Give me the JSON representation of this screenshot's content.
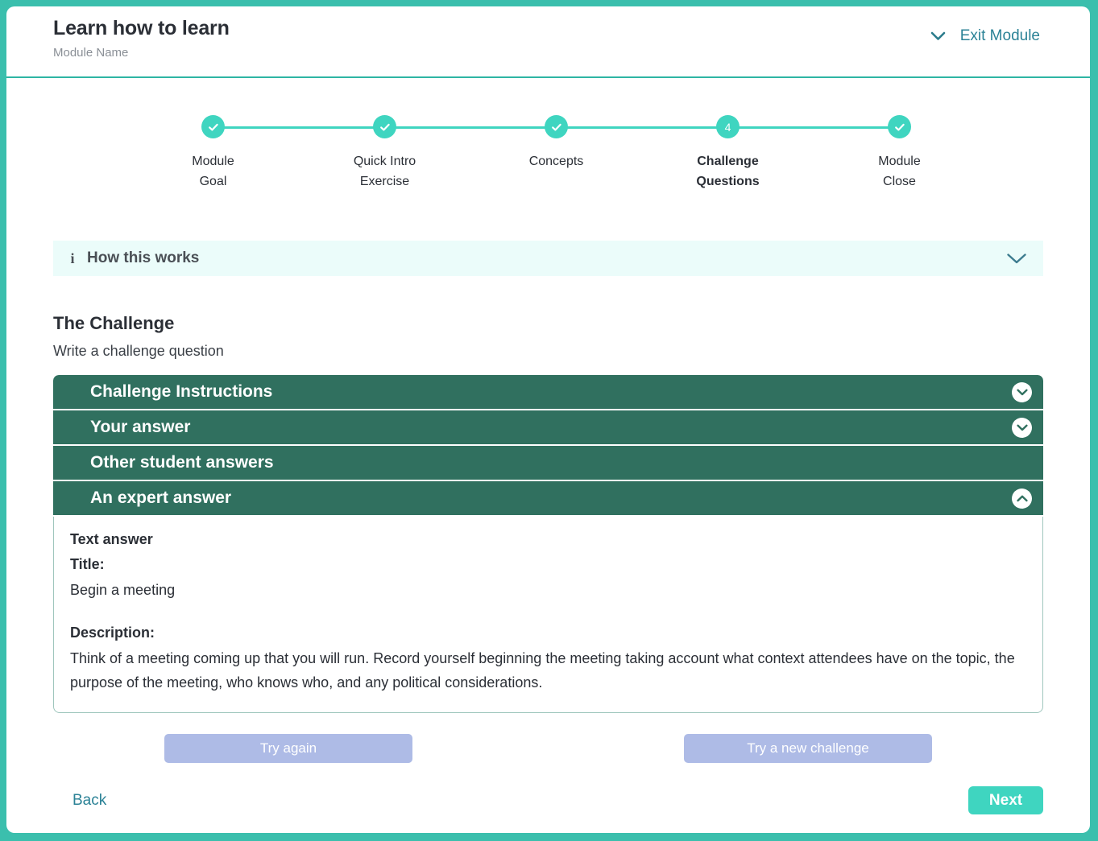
{
  "header": {
    "title": "Learn how to learn",
    "subtitle": "Module Name",
    "exit_label": "Exit Module",
    "exit_icon": "chevron-down-icon"
  },
  "stepper": {
    "steps": [
      {
        "label": "Module\nGoal",
        "state": "complete",
        "marker": "check"
      },
      {
        "label": "Quick Intro\nExercise",
        "state": "complete",
        "marker": "check"
      },
      {
        "label": "Concepts",
        "state": "complete",
        "marker": "check"
      },
      {
        "label": "Challenge\nQuestions",
        "state": "current",
        "marker": "4"
      },
      {
        "label": "Module\nClose",
        "state": "complete",
        "marker": "check"
      }
    ]
  },
  "info_bar": {
    "icon": "info-icon",
    "label": "How this works",
    "toggle_icon": "chevron-down-icon"
  },
  "challenge": {
    "title": "The Challenge",
    "subtitle": "Write a challenge question"
  },
  "accordion": {
    "rows": [
      {
        "label": "Challenge Instructions",
        "toggle": "chevron-down-circle-icon",
        "expanded": false,
        "has_toggle": true
      },
      {
        "label": "Your answer",
        "toggle": "chevron-down-circle-icon",
        "expanded": false,
        "has_toggle": true
      },
      {
        "label": "Other student answers",
        "toggle": "",
        "expanded": false,
        "has_toggle": false
      },
      {
        "label": "An expert answer",
        "toggle": "chevron-up-circle-icon",
        "expanded": true,
        "has_toggle": true
      }
    ],
    "panel": {
      "heading": "Text answer",
      "title_label": "Title:",
      "title_value": "Begin a meeting",
      "description_label": "Description:",
      "description_value": "Think of a meeting coming up that you will run. Record yourself beginning the meeting taking account what context attendees have on the topic, the purpose of the meeting, who knows who, and any political considerations."
    }
  },
  "actions": {
    "try_again": "Try again",
    "try_new_challenge": "Try a new challenge"
  },
  "footer": {
    "back": "Back",
    "next": "Next"
  },
  "colors": {
    "page_background": "#3bbfad",
    "accent_teal": "#3fd5c0",
    "link_teal": "#2b8296",
    "accordion_green": "#30705f",
    "info_bar_bg": "#ebfcfa",
    "soft_button": "#aebbe6"
  }
}
